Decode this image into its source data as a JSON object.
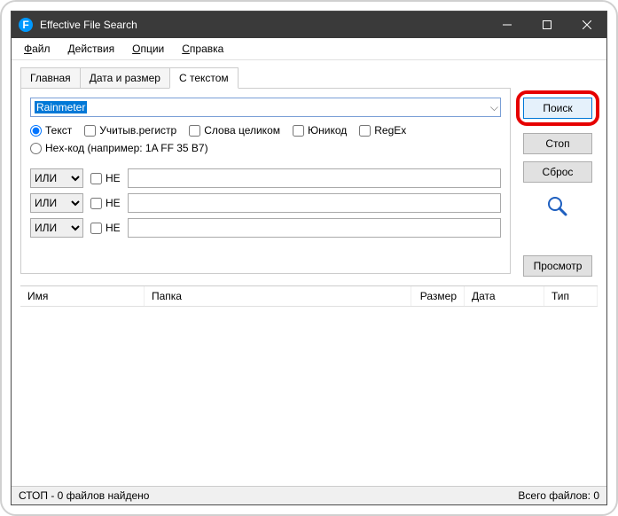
{
  "titlebar": {
    "app_icon_letter": "F",
    "title": "Effective File Search"
  },
  "menu": {
    "file": "Файл",
    "actions": "Действия",
    "options": "Опции",
    "help": "Справка"
  },
  "tabs": {
    "main": "Главная",
    "date_size": "Дата и размер",
    "with_text": "С текстом"
  },
  "search_field": {
    "value": "Rainmeter"
  },
  "text_opts": {
    "radio_text": "Текст",
    "cb_case": "Учитыв.регистр",
    "cb_whole": "Слова целиком",
    "cb_unicode": "Юникод",
    "cb_regex": "RegEx",
    "radio_hex": "Hex-код (например: 1A FF 35 B7)"
  },
  "cond": {
    "or": "ИЛИ",
    "not": "НЕ"
  },
  "buttons": {
    "search": "Поиск",
    "stop": "Стоп",
    "reset": "Сброс",
    "preview": "Просмотр"
  },
  "columns": {
    "name": "Имя",
    "folder": "Папка",
    "size": "Размер",
    "date": "Дата",
    "type": "Тип"
  },
  "status": {
    "left": "СТОП - 0 файлов найдено",
    "right": "Всего файлов: 0"
  }
}
